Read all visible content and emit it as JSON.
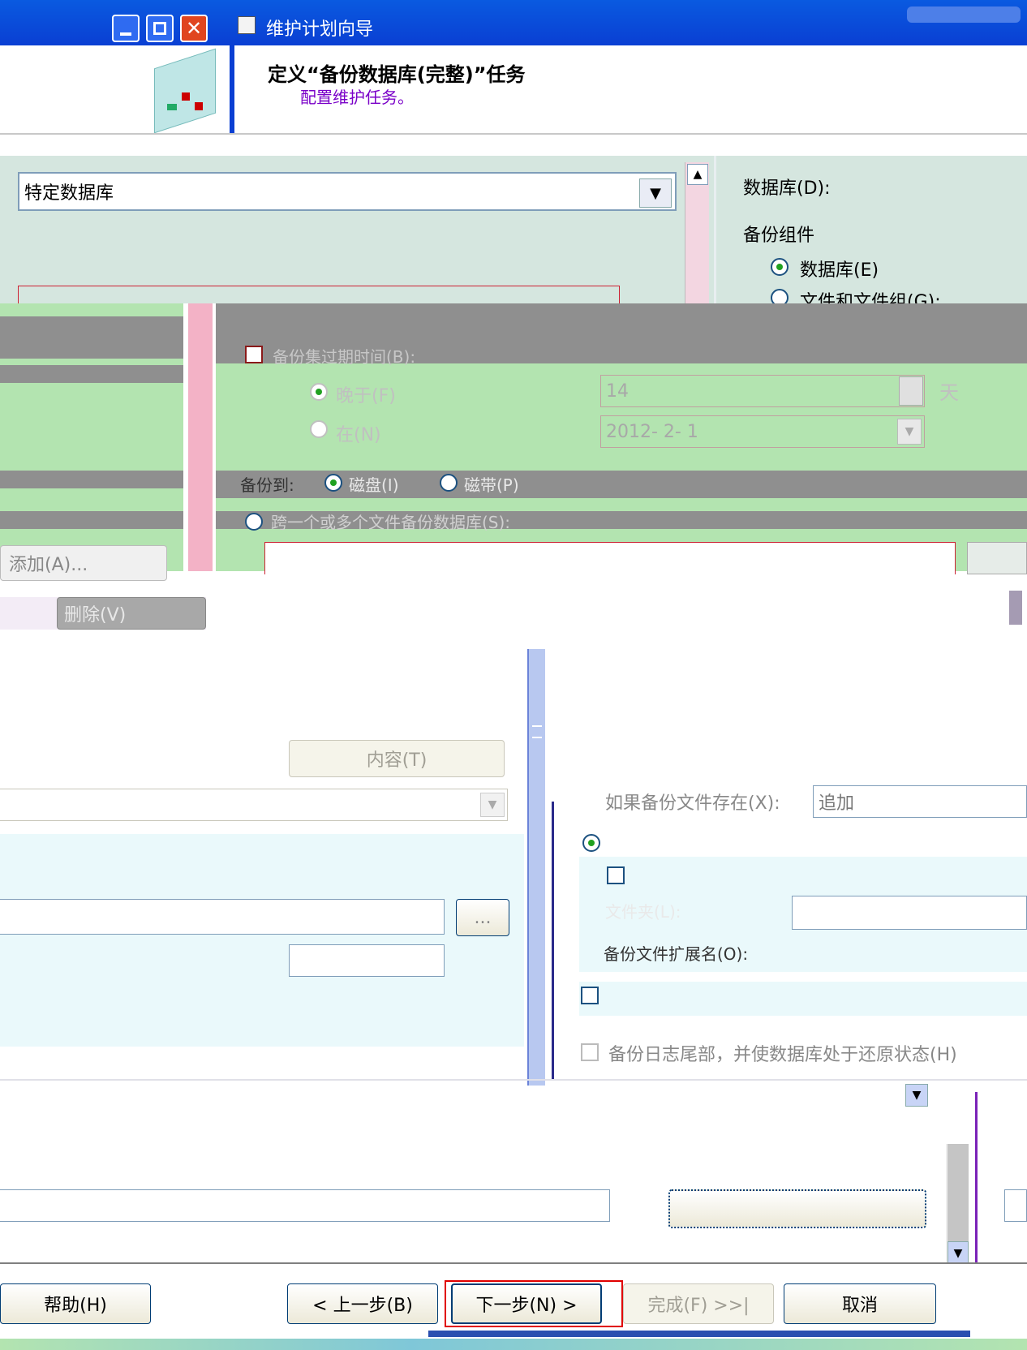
{
  "window": {
    "title": "维护计划向导"
  },
  "header": {
    "title": "定义“备份数据库(完整)”任务",
    "subtitle": "配置维护任务。"
  },
  "top_panel": {
    "dropdown_value": "特定数据库",
    "right_label_database": "数据库(D):",
    "backup_component": "备份组件",
    "radio_database": "数据库(E)",
    "radio_files": "文件和文件组(G):"
  },
  "gray_panel": {
    "expire_label": "备份集过期时间(B):",
    "after_label": "晚于(F)",
    "after_value": "14",
    "days_unit": "天",
    "on_label": "在(N)",
    "on_value": "2012- 2- 1",
    "backup_to_label": "备份到:",
    "disk_label": "磁盘(I)",
    "tape_label": "磁带(P)",
    "across_files_label": "跨一个或多个文件备份数据库(S):"
  },
  "left_buttons": {
    "add": "添加(A)...",
    "remove": "删除(V)"
  },
  "lower": {
    "contents_button": "内容(T)",
    "if_exists_label": "如果备份文件存在(X):",
    "if_exists_value": "追加",
    "folder_label": "文件夹(L):",
    "browse_button": "...",
    "extension_label": "备份文件扩展名(O):",
    "tail_log_label": "备份日志尾部，并使数据库处于还原状态(H)"
  },
  "footer": {
    "help": "帮助(H)",
    "back": "< 上一步(B)",
    "next": "下一步(N) >",
    "finish": "完成(F) >>|",
    "cancel": "取消"
  },
  "colors": {
    "accent_blue": "#0a3fd3",
    "panel_bg": "#d5e6df",
    "green_band": "#b3e4b0",
    "gray_band": "#8f8f8f",
    "light_band": "#eaf9fb",
    "highlight_red": "#e00000"
  }
}
